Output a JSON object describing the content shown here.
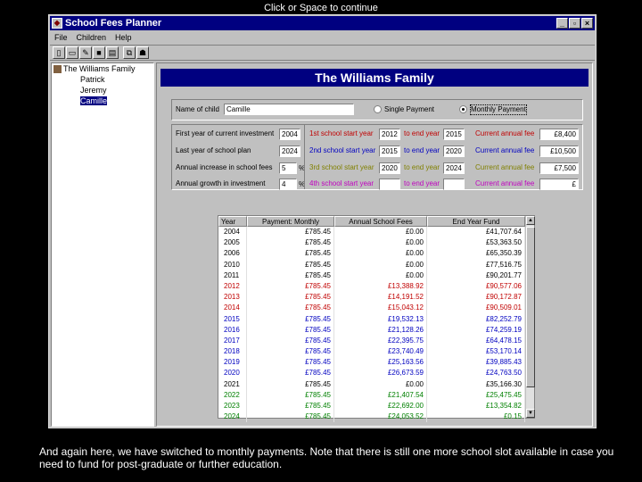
{
  "caption_top": "Click or Space to continue",
  "caption_bottom": "And again here, we have switched to monthly payments. Note that there is still one more school slot available in case you need to fund for post-graduate or further education.",
  "window": {
    "title": "School Fees Planner",
    "btn_min": "_",
    "btn_max": "▫",
    "btn_close": "×"
  },
  "menu": [
    "File",
    "Children",
    "Help"
  ],
  "tree": {
    "root": "The Williams Family",
    "children": [
      "Patrick",
      "Jeremy",
      "Camille"
    ],
    "selected": "Camille"
  },
  "banner": "The Williams Family",
  "child": {
    "name_label": "Name of child",
    "name_value": "Camille",
    "single_label": "Single Payment",
    "monthly_label": "Monthly Payment",
    "mode": "monthly"
  },
  "params": {
    "first_year_label": "First year of current investment",
    "first_year": "2004",
    "last_year_label": "Last year of school plan",
    "last_year": "2024",
    "inflation_label": "Annual increase in school fees",
    "inflation": "5",
    "growth_label": "Annual growth in investment",
    "growth": "4",
    "pct": "%"
  },
  "schools": [
    {
      "start_label": "1st school start year",
      "start": "2012",
      "end_label": "to end year",
      "end": "2015",
      "fee_label": "Current annual fee",
      "fee": "£8,400"
    },
    {
      "start_label": "2nd school start year",
      "start": "2015",
      "end_label": "to end year",
      "end": "2020",
      "fee_label": "Current annual fee",
      "fee": "£10,500"
    },
    {
      "start_label": "3rd school start year",
      "start": "2020",
      "end_label": "to end year",
      "end": "2024",
      "fee_label": "Current annual fee",
      "fee": "£7,500"
    },
    {
      "start_label": "4th school start year",
      "start": "",
      "end_label": "to end year",
      "end": "",
      "fee_label": "Current annual fee",
      "fee": "£"
    }
  ],
  "table": {
    "headers": [
      "Year",
      "Payment: Monthly",
      "Annual School Fees",
      "End Year Fund"
    ],
    "rows": [
      {
        "year": "2004",
        "pay": "£785.45",
        "fee": "£0.00",
        "fund": "£41,707.64",
        "cls": "black"
      },
      {
        "year": "2005",
        "pay": "£785.45",
        "fee": "£0.00",
        "fund": "£53,363.50",
        "cls": "black"
      },
      {
        "year": "2006",
        "pay": "£785.45",
        "fee": "£0.00",
        "fund": "£65,350.39",
        "cls": "black"
      },
      {
        "year": "2010",
        "pay": "£785.45",
        "fee": "£0.00",
        "fund": "£77,516.75",
        "cls": "black"
      },
      {
        "year": "2011",
        "pay": "£785.45",
        "fee": "£0.00",
        "fund": "£90,201.77",
        "cls": "black"
      },
      {
        "year": "2012",
        "pay": "£785.45",
        "fee": "£13,388.92",
        "fund": "£90,577.06",
        "cls": "red"
      },
      {
        "year": "2013",
        "pay": "£785.45",
        "fee": "£14,191.52",
        "fund": "£90,172.87",
        "cls": "red"
      },
      {
        "year": "2014",
        "pay": "£785.45",
        "fee": "£15,043.12",
        "fund": "£90,509.01",
        "cls": "red"
      },
      {
        "year": "2015",
        "pay": "£785.45",
        "fee": "£19,532.13",
        "fund": "£82,252.79",
        "cls": "blue"
      },
      {
        "year": "2016",
        "pay": "£785.45",
        "fee": "£21,128.26",
        "fund": "£74,259.19",
        "cls": "blue"
      },
      {
        "year": "2017",
        "pay": "£785.45",
        "fee": "£22,395.75",
        "fund": "£64,478.15",
        "cls": "blue"
      },
      {
        "year": "2018",
        "pay": "£785.45",
        "fee": "£23,740.49",
        "fund": "£53,170.14",
        "cls": "blue"
      },
      {
        "year": "2019",
        "pay": "£785.45",
        "fee": "£25,163.56",
        "fund": "£39,885.43",
        "cls": "blue"
      },
      {
        "year": "2020",
        "pay": "£785.45",
        "fee": "£26,673.59",
        "fund": "£24,763.50",
        "cls": "blue"
      },
      {
        "year": "2021",
        "pay": "£785.45",
        "fee": "£0.00",
        "fund": "£35,166.30",
        "cls": "black"
      },
      {
        "year": "2022",
        "pay": "£785.45",
        "fee": "£21,407.54",
        "fund": "£25,475.45",
        "cls": "green"
      },
      {
        "year": "2023",
        "pay": "£785.45",
        "fee": "£22,692.00",
        "fund": "£13,354.82",
        "cls": "green"
      },
      {
        "year": "2024",
        "pay": "£785.45",
        "fee": "£24,053.52",
        "fund": "£0.15",
        "cls": "green"
      }
    ]
  }
}
